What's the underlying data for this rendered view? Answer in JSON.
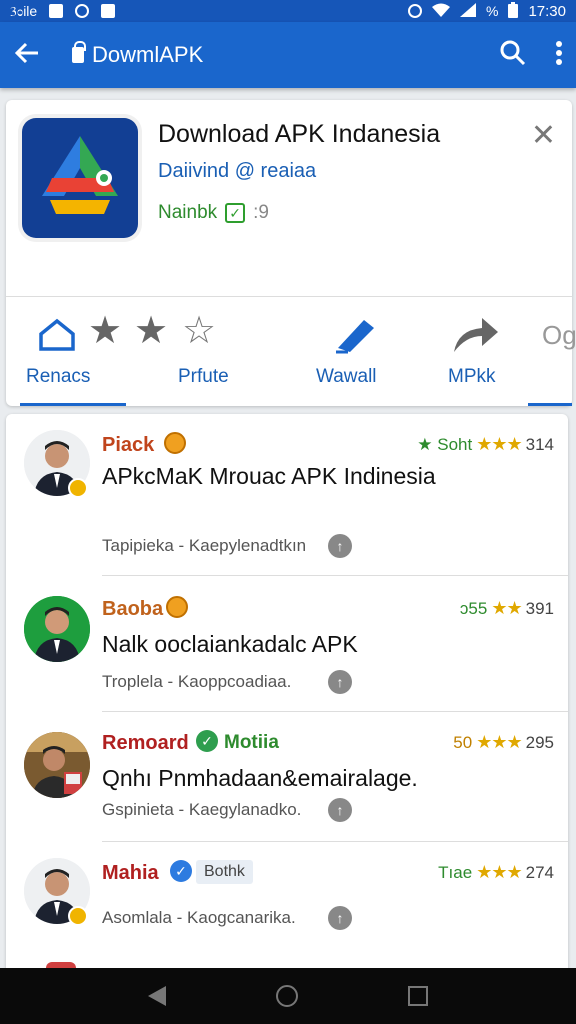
{
  "status": {
    "left": "3ಂile",
    "battery": "%",
    "time": "17:30"
  },
  "appbar": {
    "title": "DowmlAPK"
  },
  "app": {
    "name": "Download APK Indanesia",
    "developer": "Daiivind @ reaiaa",
    "badge_label": "Nainbk",
    "badge_count": ":9"
  },
  "tabs": [
    {
      "label": "Renacs"
    },
    {
      "label": "Prfute"
    },
    {
      "label": "Wawall"
    },
    {
      "label": "MPkk"
    },
    {
      "label": "Og"
    }
  ],
  "reviews": [
    {
      "name": "Piack",
      "name_color": "#c0441c",
      "rating_label": "★ Soht",
      "rating_color": "#2e8b2e",
      "stars": "★★★",
      "count": "314",
      "text": "APkcMaK Mrouac APK Indinesia",
      "meta": "Tapipieka - Kaepylenadtkın"
    },
    {
      "name": "Baoba",
      "name_color": "#c0621c",
      "rating_label": "ɔ55",
      "rating_color": "#2e8b2e",
      "stars": "★★",
      "count": "391",
      "text": "Nalk ooclaiankadalc APK",
      "meta": "Troplela - Kaoppcoadiaa."
    },
    {
      "name": "Remoard",
      "name_color": "#b02020",
      "tag": "Motiia",
      "rating_label": "50",
      "rating_color": "#c08000",
      "stars": "★★★",
      "count": "295",
      "text": "Qnhı Pnmhadaan&emairalage.",
      "meta": "Gspinieta - Kaegylanadko."
    },
    {
      "name": "Mahia",
      "name_color": "#b02020",
      "tag": "Bothk",
      "rating_label": "Tıae",
      "rating_color": "#2e8b2e",
      "stars": "★★★",
      "count": "274",
      "text": "",
      "meta": "Asomlala - Kaogcanarika."
    }
  ]
}
